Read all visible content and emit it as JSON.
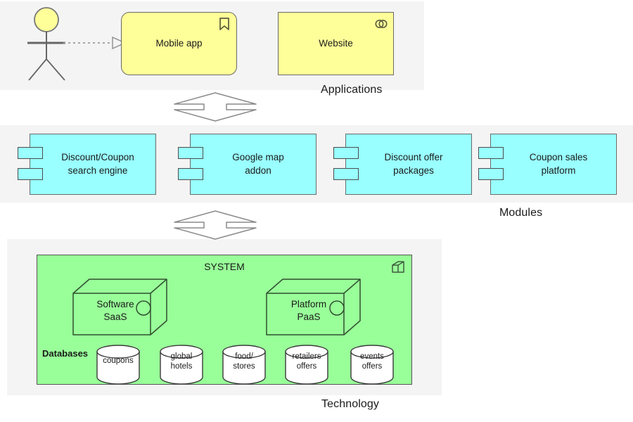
{
  "diagram": {
    "title": "Layered architecture diagram",
    "colors": {
      "application_fill": "#ffff99",
      "module_fill": "#99ffff",
      "technology_fill": "#99ff99",
      "band_fill": "#f4f4f4",
      "stroke": "#6b6b6b"
    }
  },
  "layers": {
    "applications": {
      "label": "Applications",
      "nodes": [
        {
          "label": "Mobile app",
          "icon": "bookmark-icon"
        },
        {
          "label": "Website",
          "icon": "collaboration-icon"
        }
      ],
      "actor": {
        "name": "actor-stick-figure"
      },
      "connector": {
        "name": "dependency-dashed-arrow"
      }
    },
    "modules": {
      "label": "Modules",
      "nodes": [
        {
          "label": "Discount/Coupon\nsearch engine",
          "line1": "Discount/Coupon",
          "line2": "search engine"
        },
        {
          "label": "Google map addon",
          "line1": "Google map",
          "line2": "addon"
        },
        {
          "label": "Discount offer packages",
          "line1": "Discount offer",
          "line2": "packages"
        },
        {
          "label": "Coupon sales platform",
          "line1": "Coupon sales",
          "line2": "platform"
        }
      ]
    },
    "technology": {
      "label": "Technology",
      "system": {
        "title": "SYSTEM",
        "icon": "node-cube-icon",
        "cubes": [
          {
            "line1": "Software",
            "line2": "SaaS",
            "icon": "interface-circle-icon"
          },
          {
            "line1": "Platform",
            "line2": "PaaS",
            "icon": "interface-circle-icon"
          }
        ],
        "databases_label": "Databases",
        "databases": [
          {
            "line1": "coupons",
            "line2": ""
          },
          {
            "line1": "global",
            "line2": "hotels"
          },
          {
            "line1": "food/",
            "line2": "stores"
          },
          {
            "line1": "retailers",
            "line2": "offers"
          },
          {
            "line1": "events",
            "line2": "offers"
          }
        ]
      }
    }
  },
  "connectors": {
    "applications_to_modules": "bidirectional-layer-arrow",
    "modules_to_technology": "bidirectional-layer-arrow"
  }
}
